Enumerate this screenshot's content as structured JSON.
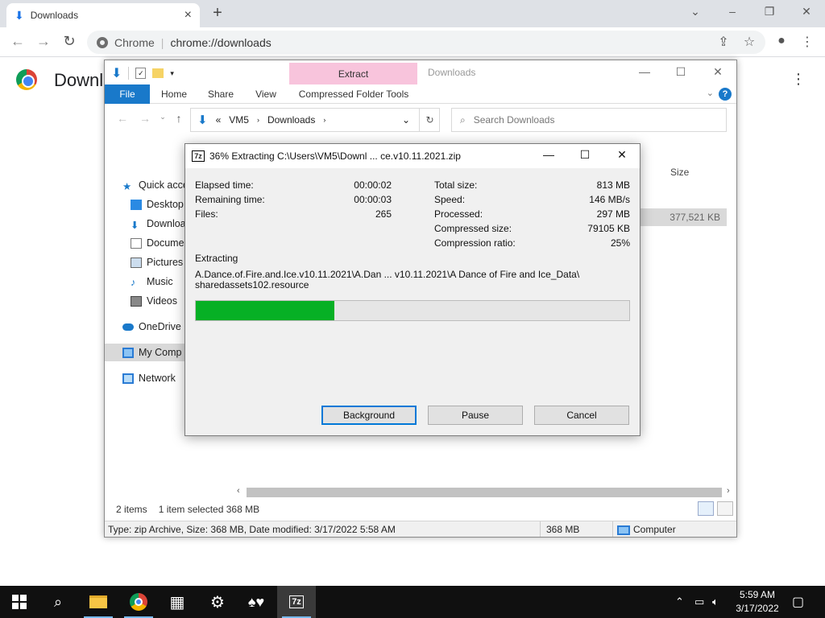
{
  "chrome": {
    "tab_title": "Downloads",
    "scheme_label": "Chrome",
    "url": "chrome://downloads",
    "page_title": "Downl"
  },
  "explorer": {
    "title": "Downloads",
    "contextual_tab": "Extract",
    "ribbon_tabs": [
      "File",
      "Home",
      "Share",
      "View",
      "Compressed Folder Tools"
    ],
    "address_path": [
      "VM5",
      "Downloads"
    ],
    "search_placeholder": "Search Downloads",
    "nav_items": [
      "Quick acce",
      "Desktop",
      "Downloa",
      "Docume",
      "Pictures",
      "Music",
      "Videos",
      "OneDrive",
      "My Comp",
      "Network"
    ],
    "column_size": "Size",
    "file_size": "377,521 KB",
    "items_count": "2 items",
    "selected_text": "1 item selected  368 MB",
    "status_info": "Type: zip Archive, Size: 368 MB, Date modified: 3/17/2022 5:58 AM",
    "status_size": "368 MB",
    "status_location": "Computer"
  },
  "dialog": {
    "title": "36% Extracting C:\\Users\\VM5\\Downl ... ce.v10.11.2021.zip",
    "left_stats": [
      {
        "label": "Elapsed time:",
        "value": "00:00:02"
      },
      {
        "label": "Remaining time:",
        "value": "00:00:03"
      },
      {
        "label": "Files:",
        "value": "265"
      }
    ],
    "right_stats": [
      {
        "label": "Total size:",
        "value": "813 MB"
      },
      {
        "label": "Speed:",
        "value": "146 MB/s"
      },
      {
        "label": "Processed:",
        "value": "297 MB"
      },
      {
        "label": "Compressed size:",
        "value": "79105 KB"
      },
      {
        "label": "Compression ratio:",
        "value": "25%"
      }
    ],
    "operation": "Extracting",
    "path_line1": "A.Dance.of.Fire.and.Ice.v10.11.2021\\A.Dan ... v10.11.2021\\A Dance of Fire and Ice_Data\\",
    "path_line2": "sharedassets102.resource",
    "progress": 0.32,
    "buttons": {
      "background": "Background",
      "pause": "Pause",
      "cancel": "Cancel"
    }
  },
  "taskbar": {
    "time": "5:59 AM",
    "date": "3/17/2022"
  },
  "colors": {
    "progress_fill": "#06b025",
    "explorer_accent": "#1979ca",
    "context_tab": "#f8c4dc"
  }
}
